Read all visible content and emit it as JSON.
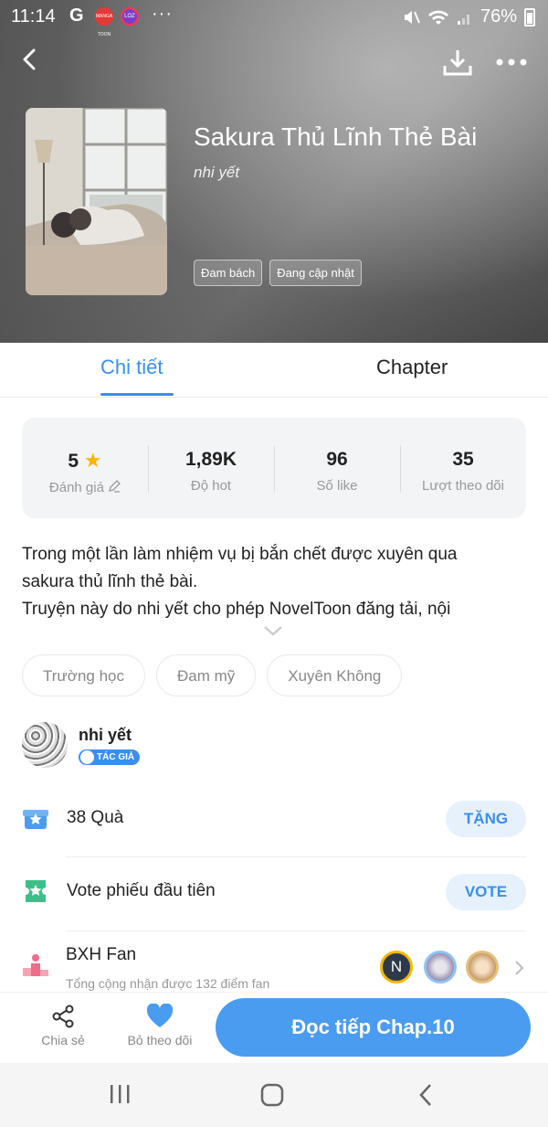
{
  "status_bar": {
    "time": "11:14",
    "g_label": "G",
    "app1_label": "MANGA TOON",
    "app2_label": "LOZ",
    "more_dots": "···",
    "battery": "76%"
  },
  "header": {
    "title": "Sakura Thủ Lĩnh Thẻ Bài",
    "author": "nhi yết",
    "tags": [
      "Đam bách",
      "Đang cập nhật"
    ]
  },
  "tabs": {
    "detail": "Chi tiết",
    "chapter": "Chapter"
  },
  "stats": {
    "rating_value": "5",
    "rating_label": "Đánh giá",
    "hot_value": "1,89K",
    "hot_label": "Độ hot",
    "like_value": "96",
    "like_label": "Số like",
    "follow_value": "35",
    "follow_label": "Lượt theo dõi"
  },
  "description": {
    "line1": "Trong một lần làm nhiệm vụ bị bắn chết được xuyên qua",
    "line2": "sakura thủ lĩnh thẻ bài.",
    "line3": "Truyện này do nhi yết cho phép NovelToon đăng tải, nội"
  },
  "topics": [
    "Trường học",
    "Đam mỹ",
    "Xuyên Không"
  ],
  "author_section": {
    "name": "nhi yết",
    "badge": "TÁC GIẢ"
  },
  "gift_row": {
    "label": "38 Quà",
    "button": "TẶNG"
  },
  "vote_row": {
    "label": "Vote phiếu đầu tiên",
    "button": "VOTE"
  },
  "fan_row": {
    "title": "BXH Fan",
    "subtitle": "Tổng cộng nhận được 132 điểm fan",
    "avatar1_letter": "N"
  },
  "bottom_bar": {
    "share": "Chia sẻ",
    "unfollow": "Bỏ theo dõi",
    "read_button": "Đọc tiếp Chap.10"
  },
  "colors": {
    "accent": "#3a8ef0",
    "star": "#f7b500"
  }
}
